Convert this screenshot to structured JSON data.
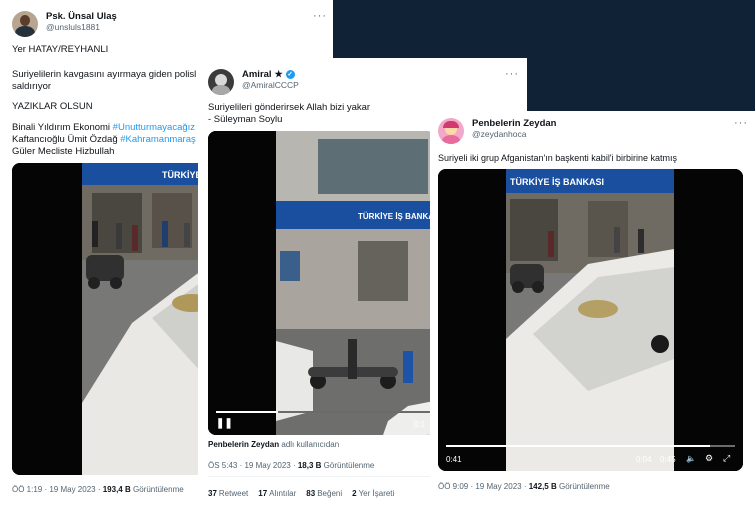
{
  "tweet1": {
    "display_name": "Psk. Ünsal Ulaş",
    "handle": "@unsluls1881",
    "lines": [
      "Yer HATAY/REYHANLI",
      "Suriyelilerin kavgasını ayırmaya giden polisl",
      "saldırıyor",
      "YAZIKLAR OLSUN",
      "Binali Yıldırım Ekonomi",
      "#Unutturmayacağız",
      "Kaftancıoğlu Ümit Özdağ",
      "#Kahramanmaraş",
      "Güler Mecliste Hizbullah"
    ],
    "time": "ÖÖ 1:19 · 19 May 2023 ·",
    "views_count": "193,4 B",
    "views_label": "Görüntülenme"
  },
  "tweet2": {
    "display_name": "Amiral",
    "handle": "@AmiralCCCP",
    "lines": [
      "Suriyelileri gönderirsek Allah bizi yakar",
      "- Süleyman Soylu"
    ],
    "video_time": "0:1",
    "attribution_name": "Penbelerin Zeydan",
    "attribution_suffix": "adlı kullanıcıdan",
    "time": "ÖS 5:43 · 19 May 2023 ·",
    "views_count": "18,3 B",
    "views_label": "Görüntülenme",
    "stats": [
      {
        "count": "37",
        "label": "Retweet"
      },
      {
        "count": "17",
        "label": "Alıntılar"
      },
      {
        "count": "83",
        "label": "Beğeni"
      },
      {
        "count": "2",
        "label": "Yer İşareti"
      }
    ]
  },
  "tweet3": {
    "display_name": "Penbelerin Zeydan",
    "handle": "@zeydanhoca",
    "text": "Suriyeli iki grup Afganistan'ın başkenti kabil'i birbirine katmış",
    "video_elapsed": "0:41",
    "video_remaining": "0:04",
    "video_total": "0:45",
    "time": "ÖÖ 9:09 · 19 May 2023 ·",
    "views_count": "142,5 B",
    "views_label": "Görüntülenme"
  },
  "bank_sign": "TÜRKİYE İŞ BANKASI",
  "colors": {
    "background": "#0f2236",
    "accent": "#1d9bf0",
    "bank_blue": "#1a4fa0"
  }
}
